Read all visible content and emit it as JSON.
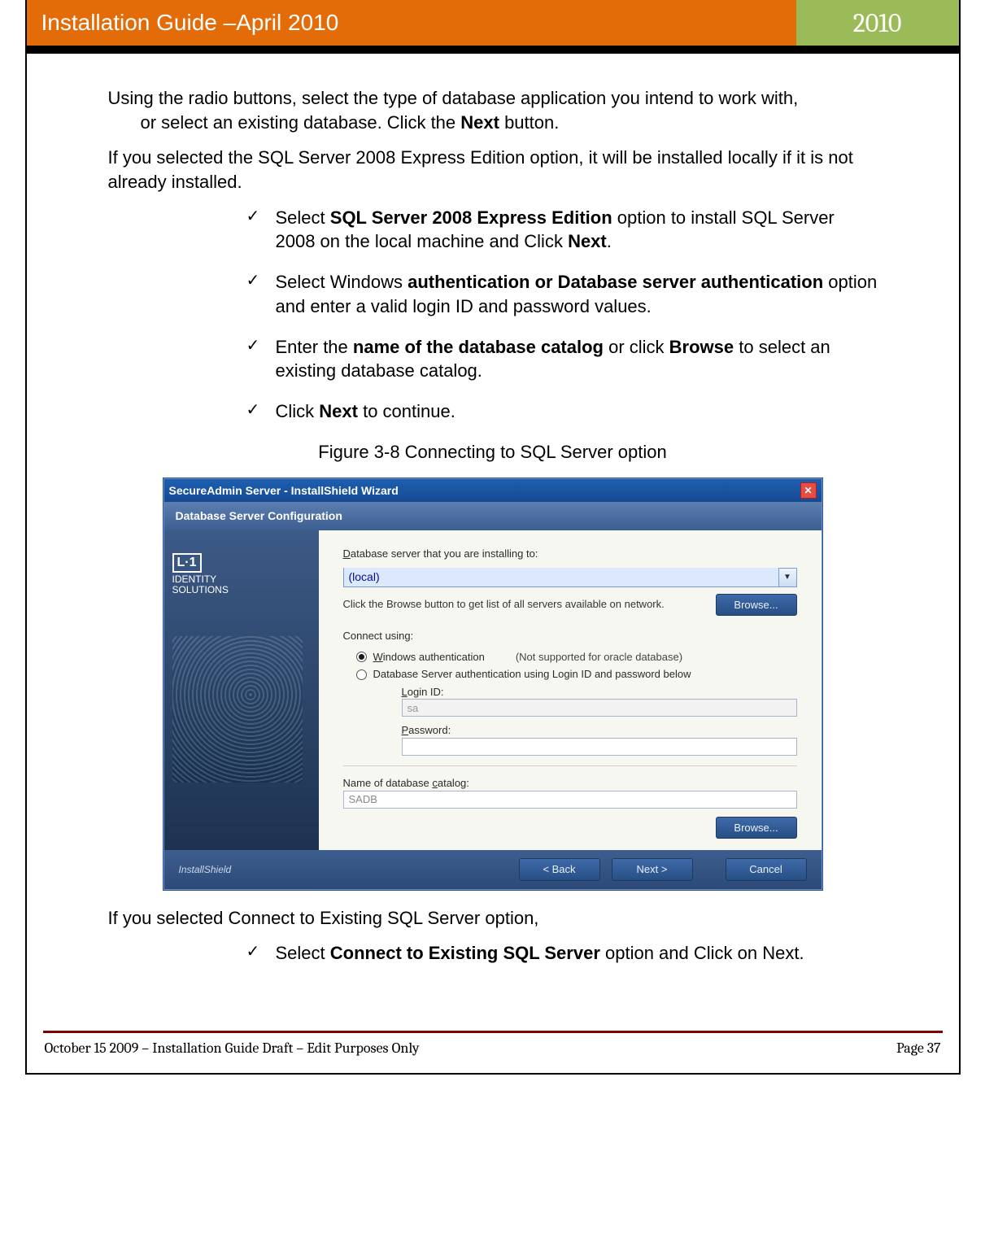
{
  "header": {
    "title_left": "Installation Guide –April 2010",
    "title_right": "2010"
  },
  "body": {
    "para1a": "Using the radio buttons, select the type of database application you intend to work with,",
    "para1b": "or select an existing database. Click the ",
    "para1_bold": "Next",
    "para1c": " button.",
    "para2": "If you selected the SQL Server 2008 Express Edition option, it will be installed locally if it is not already installed.",
    "bullets": [
      {
        "pre": "Select ",
        "b": "SQL Server 2008 Express Edition",
        "post": " option to install SQL Server 2008 on the local machine and Click ",
        "b2": "Next",
        "post2": "."
      },
      {
        "pre": "Select Windows ",
        "b": "authentication or Database server authentication",
        "post": " option and enter a valid login ID and password values."
      },
      {
        "pre": "Enter the ",
        "b": "name of the database catalog",
        "post": " or click ",
        "b2": "Browse",
        "post2": " to select an existing database catalog."
      },
      {
        "pre": "Click ",
        "b": "Next",
        "post": " to continue."
      }
    ],
    "figure_caption": "Figure 3-8 Connecting to SQL Server option",
    "after_fig": "If you selected Connect to Existing SQL Server option,",
    "bullets2": [
      {
        "pre": "Select ",
        "b": "Connect to Existing SQL Server",
        "post": " option and Click on Next."
      }
    ]
  },
  "dialog": {
    "title": "SecureAdmin Server - InstallShield Wizard",
    "subtitle": "Database Server Configuration",
    "logo_line1": "L·1",
    "logo_line2": "IDENTITY",
    "logo_line3": "SOLUTIONS",
    "server_label": "Database server that you are installing to:",
    "server_value": "(local)",
    "browse_hint": "Click the Browse button to get list of all servers available on network.",
    "browse_btn": "Browse...",
    "connect_label": "Connect using:",
    "radio1": "Windows authentication",
    "radio1_note": "(Not supported for oracle database)",
    "radio2": "Database Server authentication using Login ID and password below",
    "login_label": "Login ID:",
    "login_value": "sa",
    "password_label": "Password:",
    "password_value": "",
    "catalog_label": "Name of database catalog:",
    "catalog_value": "SADB",
    "browse2_btn": "Browse...",
    "installshield": "InstallShield",
    "btn_back": "< Back",
    "btn_next": "Next >",
    "btn_cancel": "Cancel"
  },
  "footer": {
    "left": "October 15 2009 – Installation Guide Draft – Edit Purposes Only",
    "right": "Page 37"
  }
}
